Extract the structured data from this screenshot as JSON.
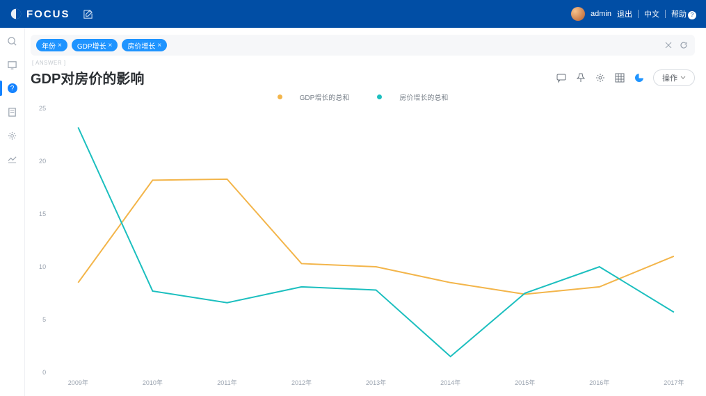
{
  "brand": "FOCUS",
  "header": {
    "user": "admin",
    "links": {
      "logout": "退出",
      "lang": "中文",
      "help": "帮助"
    }
  },
  "query": {
    "chips": [
      "年份",
      "GDP增长",
      "房价增长"
    ],
    "answer_tag": "[ ANSWER ]"
  },
  "title": "GDP对房价的影响",
  "actions": {
    "operate": "操作"
  },
  "colors": {
    "gdp": "#f3b54a",
    "house": "#1cbfbf"
  },
  "chart_data": {
    "type": "line",
    "categories": [
      "2009年",
      "2010年",
      "2011年",
      "2012年",
      "2013年",
      "2014年",
      "2015年",
      "2016年",
      "2017年"
    ],
    "ylim": [
      0,
      25
    ],
    "yticks": [
      0,
      5,
      10,
      15,
      20,
      25
    ],
    "series": [
      {
        "name": "GDP增长的总和",
        "color": "#f3b54a",
        "values": [
          8.5,
          18.2,
          18.3,
          10.3,
          10.0,
          8.5,
          7.4,
          8.1,
          11.0
        ]
      },
      {
        "name": "房价增长的总和",
        "color": "#1cbfbf",
        "values": [
          23.2,
          7.7,
          6.6,
          8.1,
          7.8,
          1.5,
          7.5,
          10.0,
          5.7
        ]
      }
    ]
  }
}
